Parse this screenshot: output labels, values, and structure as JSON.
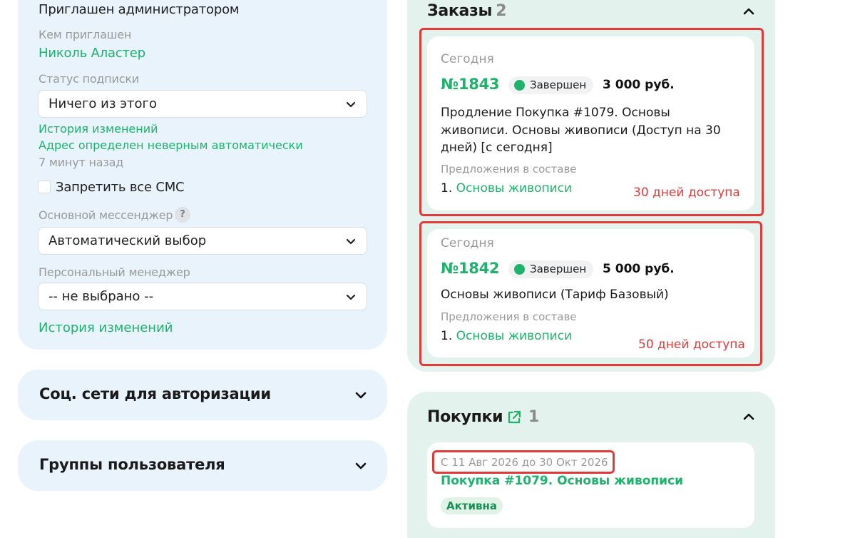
{
  "profile": {
    "invited_by_admin": "Приглашен администратором",
    "invited_by_label": "Кем приглашен",
    "invited_by_name": "Николь Аластер",
    "subscription_label": "Статус подписки",
    "subscription_value": "Ничего из этого",
    "history_link": "История изменений",
    "address_link": "Адрес определен неверным автоматически",
    "time_ago": "7 минут назад",
    "block_sms_label": "Запретить все СМС",
    "messenger_label": "Основной мессенджер",
    "messenger_help": "?",
    "messenger_value": "Автоматический выбор",
    "manager_label": "Персональный менеджер",
    "manager_value": "-- не выбрано --",
    "history_link_2": "История изменений"
  },
  "social": {
    "title": "Соц. сети для авторизации"
  },
  "groups": {
    "title": "Группы пользователя"
  },
  "orders": {
    "title": "Заказы",
    "count": "2",
    "items": [
      {
        "date": "Сегодня",
        "number": "№1843",
        "status": "Завершен",
        "price": "3 000 руб.",
        "desc_lines": [
          "Продление Покупка #1079. Основы",
          "живописи. Основы живописи (Доступ на 30",
          "дней) [с сегодня]"
        ],
        "offers_label": "Предложения в составе",
        "offer_num": "1.",
        "offer_link": "Основы живописи",
        "note": "30 дней доступа"
      },
      {
        "date": "Сегодня",
        "number": "№1842",
        "status": "Завершен",
        "price": "5 000 руб.",
        "desc_lines": [
          "Основы живописи (Тариф Базовый)"
        ],
        "offers_label": "Предложения в составе",
        "offer_num": "1.",
        "offer_link": "Основы живописи",
        "note": "50 дней доступа"
      }
    ]
  },
  "purchases": {
    "title": "Покупки",
    "count": "1",
    "item": {
      "period": "С 11 Авг 2026 до 30 Окт 2026",
      "name": "Покупка #1079. Основы живописи",
      "status": "Активна"
    }
  },
  "colors": {
    "accent_green": "#1db36b",
    "highlight_red": "#e03a3a",
    "left_panel_bg": "#e9f3fb",
    "right_panel_bg": "#e3f2ec"
  }
}
